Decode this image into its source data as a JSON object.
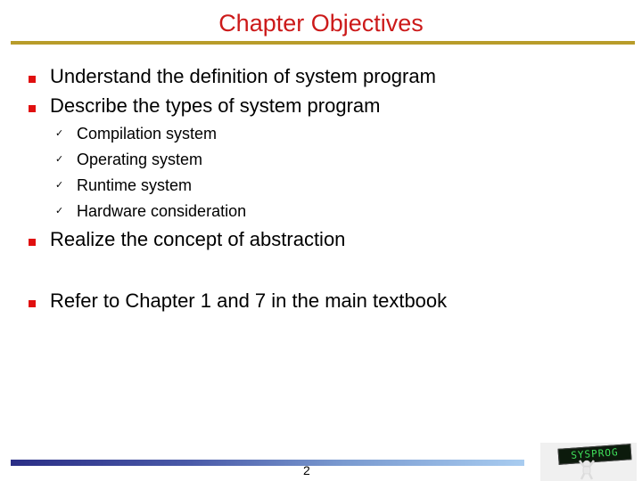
{
  "slide": {
    "title": "Chapter Objectives",
    "bullets": [
      "Understand the definition of system program",
      "Describe the types of system program",
      "Realize the concept of abstraction",
      "Refer to Chapter 1 and 7 in the main textbook"
    ],
    "sub_items": [
      "Compilation system",
      "Operating system",
      "Runtime system",
      "Hardware consideration"
    ],
    "check_glyph": "✓",
    "page_number": "2",
    "logo_text": "SYSPROG"
  },
  "colors": {
    "title": "#cc1a1a",
    "title_rule": "#b89c2a",
    "bullet": "#e01010",
    "footer_start": "#2a2e86",
    "footer_end": "#a8ccf0"
  }
}
